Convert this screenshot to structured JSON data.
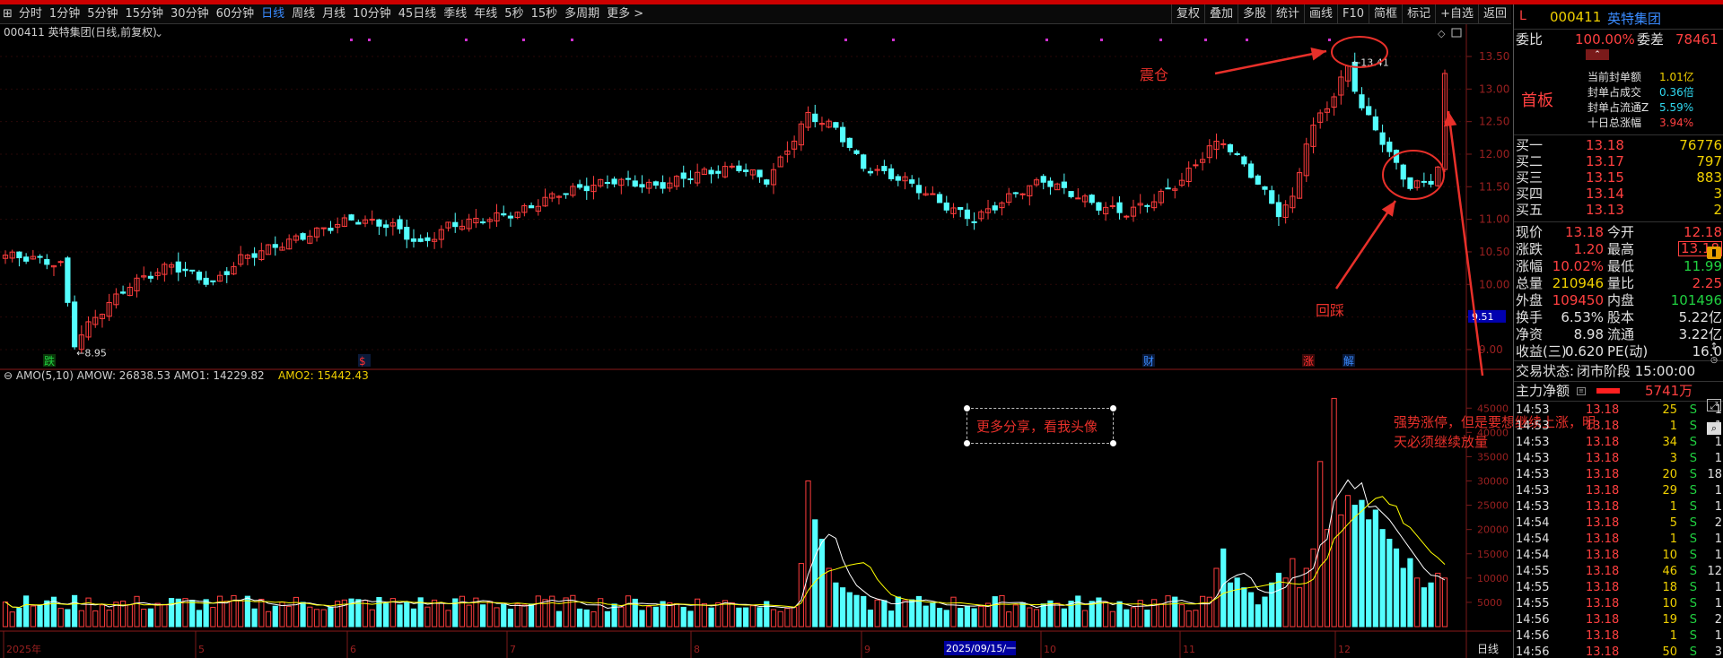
{
  "toolbar": {
    "left": [
      "分时",
      "1分钟",
      "5分钟",
      "15分钟",
      "30分钟",
      "60分钟",
      "日线",
      "周线",
      "月线",
      "10分钟",
      "45日线",
      "季线",
      "年线",
      "5秒",
      "15秒",
      "多周期",
      "更多 >"
    ],
    "active_index": 6,
    "right": [
      "复权",
      "叠加",
      "多股",
      "统计",
      "画线",
      "F10",
      "简框",
      "标记",
      "+自选",
      "返回"
    ]
  },
  "chart": {
    "title": "000411 英特集团(日线,前复权)",
    "price_ticks": [
      "13.50",
      "13.00",
      "12.50",
      "12.00",
      "11.50",
      "11.00",
      "10.50",
      "10.00",
      "9.50",
      "9.00"
    ],
    "current_price_tag": "9.51",
    "high_label": "13.41",
    "low_label": "8.95",
    "markers": [
      "跌",
      "$",
      "财",
      "涨",
      "解"
    ],
    "indicator_label": "AMO(5,10)",
    "amow_label": "AMOW: 26838.53",
    "amo1_label": "AMO1: 14229.82",
    "amo2_label": "AMO2: 15442.43",
    "volume_ticks": [
      "45000",
      "40000",
      "35000",
      "30000",
      "25000",
      "20000",
      "15000",
      "10000",
      "5000"
    ],
    "date_labels": [
      "2025年",
      "5",
      "6",
      "7",
      "8",
      "9",
      "10",
      "11",
      "12"
    ],
    "selected_date": "2025/09/15/一",
    "period_tab": "日线",
    "colors": {
      "up": "#ff3d3d",
      "down": "#54ffff",
      "ma_white": "#ffffff",
      "ma_yellow": "#ffff00",
      "arrow": "#e8302a"
    }
  },
  "annotations": {
    "zhencang": "震仓",
    "huicai": "回踩",
    "share_box": "更多分享，看我头像",
    "strong_line1": "强势涨停，但是要想继续上涨，明",
    "strong_line2": "天必须继续放量"
  },
  "panel": {
    "code_marker": "L",
    "code": "000411",
    "name": "英特集团",
    "weibi_label": "委比",
    "weibi_value": "100.00%",
    "weicha_label": "委差",
    "weicha_value": "78461",
    "board_label": "首板",
    "info": [
      {
        "label": "当前封单额",
        "value": "1.01亿"
      },
      {
        "label": "封单占成交",
        "value": "0.36倍"
      },
      {
        "label": "封单占流通Z",
        "value": "5.59%"
      },
      {
        "label": "十日总涨幅",
        "value": "3.94%"
      }
    ],
    "bids": [
      {
        "label": "买一",
        "price": "13.18",
        "vol": "76776"
      },
      {
        "label": "买二",
        "price": "13.17",
        "vol": "797"
      },
      {
        "label": "买三",
        "price": "13.15",
        "vol": "883"
      },
      {
        "label": "买四",
        "price": "13.14",
        "vol": "3"
      },
      {
        "label": "买五",
        "price": "13.13",
        "vol": "2"
      }
    ],
    "quote": [
      {
        "l1": "现价",
        "v1": "13.18",
        "l2": "今开",
        "v2": "12.18"
      },
      {
        "l1": "涨跌",
        "v1": "1.20",
        "l2": "最高",
        "v2": "13.18"
      },
      {
        "l1": "涨幅",
        "v1": "10.02%",
        "l2": "最低",
        "v2": "11.99"
      },
      {
        "l1": "总量",
        "v1": "210946",
        "l2": "量比",
        "v2": "2.25"
      },
      {
        "l1": "外盘",
        "v1": "109450",
        "l2": "内盘",
        "v2": "101496"
      },
      {
        "l1": "换手",
        "v1": "6.53%",
        "l2": "股本",
        "v2": "5.22亿"
      },
      {
        "l1": "净资",
        "v1": "8.98",
        "l2": "流通",
        "v2": "3.22亿"
      },
      {
        "l1": "收益(三)",
        "v1": "0.620",
        "l2": "PE(动)",
        "v2": "16.0"
      }
    ],
    "trade_status_label": "交易状态:",
    "trade_status_value": "闭市阶段 15:00:00",
    "net_label": "主力净额",
    "net_value": "5741万",
    "ticks": [
      {
        "t": "14:53",
        "p": "13.18",
        "v": "25",
        "s": "S",
        "n": "1"
      },
      {
        "t": "14:53",
        "p": "13.18",
        "v": "1",
        "s": "S",
        "n": "1"
      },
      {
        "t": "14:53",
        "p": "13.18",
        "v": "34",
        "s": "S",
        "n": "1"
      },
      {
        "t": "14:53",
        "p": "13.18",
        "v": "3",
        "s": "S",
        "n": "1"
      },
      {
        "t": "14:53",
        "p": "13.18",
        "v": "20",
        "s": "S",
        "n": "18"
      },
      {
        "t": "14:53",
        "p": "13.18",
        "v": "29",
        "s": "S",
        "n": "1"
      },
      {
        "t": "14:53",
        "p": "13.18",
        "v": "1",
        "s": "S",
        "n": "1"
      },
      {
        "t": "14:54",
        "p": "13.18",
        "v": "5",
        "s": "S",
        "n": "2"
      },
      {
        "t": "14:54",
        "p": "13.18",
        "v": "1",
        "s": "S",
        "n": "1"
      },
      {
        "t": "14:54",
        "p": "13.18",
        "v": "10",
        "s": "S",
        "n": "1"
      },
      {
        "t": "14:55",
        "p": "13.18",
        "v": "46",
        "s": "S",
        "n": "12"
      },
      {
        "t": "14:55",
        "p": "13.18",
        "v": "18",
        "s": "S",
        "n": "1"
      },
      {
        "t": "14:55",
        "p": "13.18",
        "v": "10",
        "s": "S",
        "n": "1"
      },
      {
        "t": "14:56",
        "p": "13.18",
        "v": "19",
        "s": "S",
        "n": "2"
      },
      {
        "t": "14:56",
        "p": "13.18",
        "v": "1",
        "s": "S",
        "n": "1"
      },
      {
        "t": "14:56",
        "p": "13.18",
        "v": "50",
        "s": "S",
        "n": "3"
      }
    ]
  }
}
